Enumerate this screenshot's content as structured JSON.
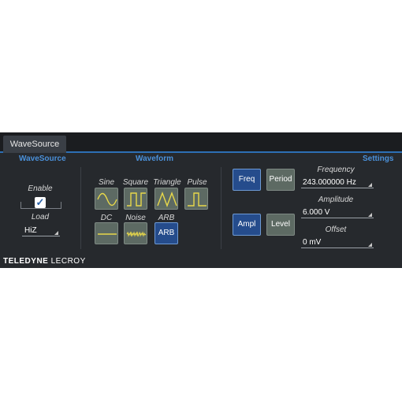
{
  "tab": {
    "label": "WaveSource"
  },
  "sections": {
    "wavesource": "WaveSource",
    "waveform": "Waveform",
    "settings": "Settings"
  },
  "wavesource": {
    "enable_label": "Enable",
    "enable_checked": true,
    "load_label": "Load",
    "load_value": "HiZ"
  },
  "waveform": {
    "labels": {
      "sine": "Sine",
      "square": "Square",
      "triangle": "Triangle",
      "pulse": "Pulse",
      "dc": "DC",
      "noise": "Noise",
      "arb": "ARB"
    },
    "arb_button": "ARB",
    "selected": "ARB"
  },
  "settings": {
    "freq_button": "Freq",
    "period_button": "Period",
    "ampl_button": "Ampl",
    "level_button": "Level",
    "frequency_label": "Frequency",
    "frequency_value": "243.000000 Hz",
    "amplitude_label": "Amplitude",
    "amplitude_value": "6.000 V",
    "offset_label": "Offset",
    "offset_value": "0 mV"
  },
  "brand": {
    "bold": "TELEDYNE",
    "light": " LECROY"
  },
  "colors": {
    "accent": "#4a90d9",
    "selected_button": "#254c8c",
    "button": "#5d6a63",
    "waveform_glyph": "#e8d84a"
  }
}
